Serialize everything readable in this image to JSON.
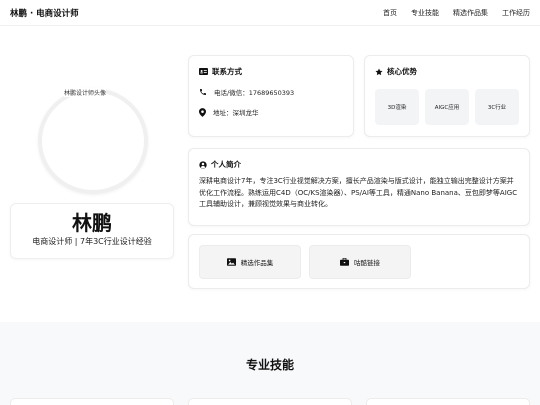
{
  "nav": {
    "brand": "林鹏 · 电商设计师",
    "links": [
      "首页",
      "专业技能",
      "精选作品集",
      "工作经历"
    ]
  },
  "profile": {
    "avatar_alt": "林鹏设计师头像",
    "name": "林鹏",
    "role": "电商设计师 | 7年3C行业设计经验"
  },
  "contact": {
    "title": "联系方式",
    "phone": "电话/微信：17689650393",
    "address": "地址：深圳龙华"
  },
  "advantages": {
    "title": "核心优势",
    "tags": [
      "3D渲染",
      "AIGC应用",
      "3C行业"
    ]
  },
  "intro": {
    "title": "个人简介",
    "text": "深耕电商设计7年，专注3C行业视觉解决方案，擅长产品渲染与版式设计，能独立输出完整设计方案并优化工作流程。熟练运用C4D（OC/KS渲染器）、PS/AI等工具，精通Nano Banana、豆包即梦等AIGC工具辅助设计，兼顾视觉效果与商业转化。"
  },
  "actions": {
    "portfolio": "精选作品集",
    "xianyu": "咕酷链接"
  },
  "skills": {
    "title": "专业技能"
  },
  "icons": {
    "contact": "id-card-icon",
    "advantages": "star-icon",
    "phone": "phone-icon",
    "location": "map-pin-icon",
    "intro": "user-circle-icon",
    "portfolio": "image-icon",
    "xianyu": "briefcase-icon"
  }
}
